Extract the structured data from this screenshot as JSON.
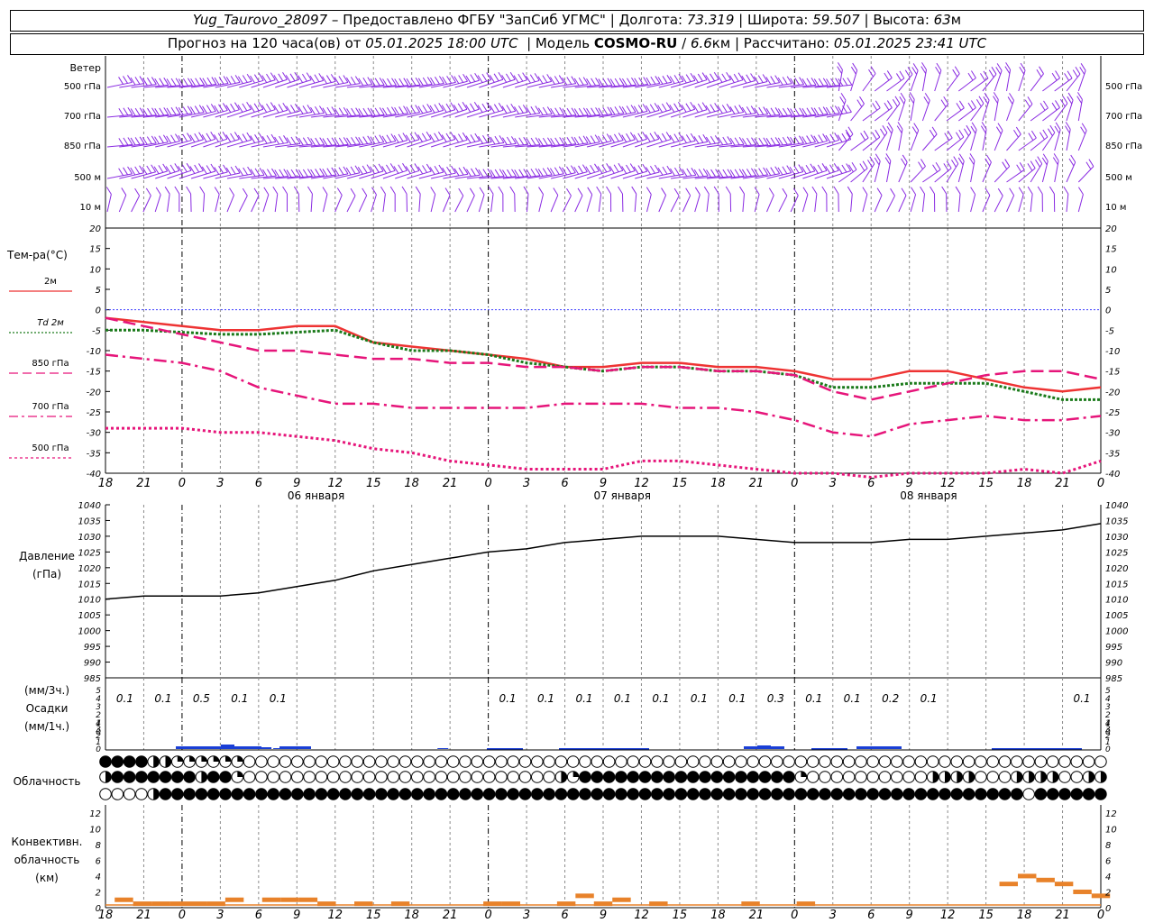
{
  "header": {
    "station": "Yug_Taurovo_28097",
    "provider": "– Предоставлено ФГБУ \"ЗапСиб УГМС\"",
    "lon_label": "Долгота:",
    "lon": "73.319",
    "lat_label": "Широта:",
    "lat": "59.507",
    "alt_label": "Высота:",
    "alt": "63",
    "alt_unit": "м",
    "forecast_label": "Прогноз на 120 часа(ов)  от",
    "forecast_time": "05.01.2025 18:00 UTC",
    "model_label": "Модель",
    "model": "COSMO-RU",
    "model_res": "6.6",
    "model_res_unit": "км",
    "calc_label": "Рассчитано:",
    "calc_time": "05.01.2025 23:41 UTC"
  },
  "x_axis": {
    "hour_ticks": [
      "18",
      "21",
      "0",
      "3",
      "6",
      "9",
      "12",
      "15",
      "18",
      "21",
      "0",
      "3",
      "6",
      "9",
      "12",
      "15",
      "18",
      "21",
      "0",
      "3",
      "6",
      "9",
      "12",
      "15",
      "18",
      "21",
      "0"
    ],
    "date_labels": [
      "06 января",
      "07 января",
      "08 января"
    ]
  },
  "colors": {
    "wind": "#8a2be2",
    "temp": "#ee3333",
    "dew": "#1a7a1a",
    "upper": "#e6157a",
    "pressure": "#000000",
    "precip": "#1a3fd6",
    "conv": "#e8822a",
    "zero": "#3a3aff",
    "grid": "#8c8c8c"
  },
  "wind_panel": {
    "title": "Ветер",
    "levels": [
      "500 гПа",
      "700 гПа",
      "850 гПа",
      "500  м",
      "10   м"
    ]
  },
  "temp_panel": {
    "title": "Тем-ра(°С)",
    "legend": [
      {
        "label": "2м",
        "style": "solid-red"
      },
      {
        "label": "Td  2м",
        "style": "dotted-green"
      },
      {
        "label": "850 гПа",
        "style": "dash-pink"
      },
      {
        "label": "700 гПа",
        "style": "dashdot-pink"
      },
      {
        "label": "500 гПа",
        "style": "dotted-pink"
      }
    ],
    "y_ticks": [
      "20",
      "15",
      "10",
      "5",
      "0",
      "-5",
      "-10",
      "-15",
      "-20",
      "-25",
      "-30",
      "-35",
      "-40"
    ]
  },
  "pressure_panel": {
    "title": "Давление",
    "unit": "(гПа)",
    "y_ticks": [
      "1040",
      "1035",
      "1030",
      "1025",
      "1020",
      "1015",
      "1010",
      "1005",
      "1000",
      "995",
      "990",
      "985"
    ]
  },
  "precip_panel": {
    "title_top": "(мм/3ч.)",
    "title": "Осадки",
    "title_bottom": "(мм/1ч.)",
    "y_ticks": [
      "5",
      "4",
      "3",
      "2",
      "1",
      "0",
      "4",
      "3",
      "2",
      "1",
      "0"
    ],
    "totals": [
      {
        "x": 1,
        "v": "0.1"
      },
      {
        "x": 2,
        "v": "0.1"
      },
      {
        "x": 3,
        "v": "0.5"
      },
      {
        "x": 4,
        "v": "0.1"
      },
      {
        "x": 5,
        "v": "0.1"
      },
      {
        "x": 11,
        "v": "0.1"
      },
      {
        "x": 12,
        "v": "0.1"
      },
      {
        "x": 13,
        "v": "0.1"
      },
      {
        "x": 14,
        "v": "0.1"
      },
      {
        "x": 15,
        "v": "0.1"
      },
      {
        "x": 16,
        "v": "0.1"
      },
      {
        "x": 17,
        "v": "0.1"
      },
      {
        "x": 18,
        "v": "0.3"
      },
      {
        "x": 19,
        "v": "0.1"
      },
      {
        "x": 20,
        "v": "0.1"
      },
      {
        "x": 21,
        "v": "0.2"
      },
      {
        "x": 22,
        "v": "0.1"
      },
      {
        "x": 26,
        "v": "0.1"
      }
    ]
  },
  "cloud_panel": {
    "title": "Облачность"
  },
  "conv_panel": {
    "title1": "Конвективн.",
    "title2": "облачность",
    "title3": "(км)",
    "y_ticks": [
      "12",
      "10",
      "8",
      "6",
      "4",
      "2",
      "0"
    ]
  },
  "chart_data": [
    {
      "type": "line",
      "title": "Тем-ра(°С)",
      "x_hours": [
        0,
        3,
        6,
        9,
        12,
        15,
        18,
        21,
        24,
        27,
        30,
        33,
        36,
        39,
        42,
        45,
        48,
        51,
        54,
        57,
        60,
        63,
        66,
        69,
        72,
        75,
        78
      ],
      "ylim": [
        -40,
        20
      ],
      "series": [
        {
          "name": "2м",
          "values": [
            -2,
            -3,
            -4,
            -5,
            -5,
            -4,
            -4,
            -8,
            -9,
            -10,
            -11,
            -12,
            -14,
            -14,
            -13,
            -13,
            -14,
            -14,
            -15,
            -17,
            -17,
            -15,
            -15,
            -17,
            -19,
            -20,
            -19
          ]
        },
        {
          "name": "Td  2м",
          "values": [
            -5,
            -5,
            -5.5,
            -6,
            -6,
            -5.5,
            -5,
            -8,
            -10,
            -10,
            -11,
            -13,
            -14,
            -15,
            -14,
            -14,
            -15,
            -15,
            -16,
            -19,
            -19,
            -18,
            -18,
            -18,
            -20,
            -22,
            -22
          ]
        },
        {
          "name": "850 гПа",
          "values": [
            -2,
            -4,
            -6,
            -8,
            -10,
            -10,
            -11,
            -12,
            -12,
            -13,
            -13,
            -14,
            -14,
            -15,
            -14,
            -14,
            -15,
            -15,
            -16,
            -20,
            -22,
            -20,
            -18,
            -16,
            -15,
            -15,
            -17
          ]
        },
        {
          "name": "700 гПа",
          "values": [
            -11,
            -12,
            -13,
            -15,
            -19,
            -21,
            -23,
            -23,
            -24,
            -24,
            -24,
            -24,
            -23,
            -23,
            -23,
            -24,
            -24,
            -25,
            -27,
            -30,
            -31,
            -28,
            -27,
            -26,
            -27,
            -27,
            -26
          ]
        },
        {
          "name": "500 гПа",
          "values": [
            -29,
            -29,
            -29,
            -30,
            -30,
            -31,
            -32,
            -34,
            -35,
            -37,
            -38,
            -39,
            -39,
            -39,
            -37,
            -37,
            -38,
            -39,
            -40,
            -40,
            -41,
            -40,
            -40,
            -40,
            -39,
            -40,
            -37
          ]
        }
      ]
    },
    {
      "type": "line",
      "title": "Давление",
      "x_hours": [
        0,
        3,
        6,
        9,
        12,
        15,
        18,
        21,
        24,
        27,
        30,
        33,
        36,
        39,
        42,
        45,
        48,
        51,
        54,
        57,
        60,
        63,
        66,
        69,
        72,
        75,
        78
      ],
      "ylim": [
        985,
        1040
      ],
      "series": [
        {
          "name": "",
          "values": [
            1010,
            1011,
            1011,
            1011,
            1012,
            1014,
            1016,
            1019,
            1021,
            1023,
            1025,
            1026,
            1028,
            1029,
            1030,
            1030,
            1030,
            1029,
            1028,
            1028,
            1028,
            1029,
            1029,
            1030,
            1031,
            1032,
            1034
          ]
        }
      ]
    },
    {
      "type": "bar",
      "title": "Осадки",
      "x_hours": [
        1,
        2,
        3,
        4,
        5,
        6,
        7,
        8,
        9,
        10,
        11,
        12,
        13,
        14,
        15,
        16,
        17,
        18,
        19,
        20,
        21,
        22,
        23,
        24,
        25,
        26,
        27
      ],
      "values": [
        0,
        0,
        0,
        0.1,
        0.2,
        0.3,
        0.2,
        0.1,
        0.2,
        0,
        0,
        0,
        0,
        0,
        0,
        0,
        0,
        0,
        0,
        0,
        0.1,
        0,
        0,
        0,
        0,
        0,
        0
      ]
    },
    {
      "type": "bar",
      "title": "Конвективн. облачность",
      "ylim": [
        0,
        13
      ],
      "values": [
        {
          "h": 1,
          "v": 1.0
        },
        {
          "h": 2,
          "v": 0.5
        },
        {
          "h": 3,
          "v": 0.5
        },
        {
          "h": 4,
          "v": 0.5
        },
        {
          "h": 5,
          "v": 0.5
        },
        {
          "h": 6,
          "v": 0.5
        },
        {
          "h": 7,
          "v": 1.0
        },
        {
          "h": 9,
          "v": 1.0
        },
        {
          "h": 10,
          "v": 1.0
        },
        {
          "h": 11,
          "v": 1.0
        },
        {
          "h": 12,
          "v": 0.5
        },
        {
          "h": 14,
          "v": 0.5
        },
        {
          "h": 16,
          "v": 0.5
        },
        {
          "h": 21,
          "v": 0.5
        },
        {
          "h": 22,
          "v": 0.5
        },
        {
          "h": 25,
          "v": 0.5
        },
        {
          "h": 26,
          "v": 1.5
        },
        {
          "h": 27,
          "v": 0.5
        },
        {
          "h": 28,
          "v": 1.0
        },
        {
          "h": 30,
          "v": 0.5
        },
        {
          "h": 35,
          "v": 0.5
        },
        {
          "h": 38,
          "v": 0.5
        },
        {
          "h": 49,
          "v": 3.0
        },
        {
          "h": 50,
          "v": 4.0
        },
        {
          "h": 51,
          "v": 3.5
        },
        {
          "h": 52,
          "v": 3.0
        },
        {
          "h": 53,
          "v": 2.0
        },
        {
          "h": 54,
          "v": 1.5
        }
      ]
    },
    {
      "type": "table",
      "title": "Облачность",
      "rows": [
        {
          "row": "upper",
          "pattern": "FFFFHHQQQQQQEEEEEEEEEEEEEEEEEEEEEEEEEEEEEEEEEEEEEEEEEEEEEEEEEEEEEEEEEEEEEEEEEEEEEEEE"
        },
        {
          "row": "middle",
          "pattern": "HFFFFFFFHFFQEEEEEEEEEEEEEEEEEEEEEEEEEEHQFFFFFFFFFFFFFFFFFFQEEEEEEEEEEHHHHEEEHHHHEEHH"
        },
        {
          "row": "lower",
          "pattern": "EEEEHFFFFFFFFFFFFFFFFFFFFFFFFFFFFFFFFFFFFFFFFFFFFFFFFFFFFFFFFFFFFFFFFFFFFFFFFEFFFFFF"
        }
      ]
    }
  ]
}
